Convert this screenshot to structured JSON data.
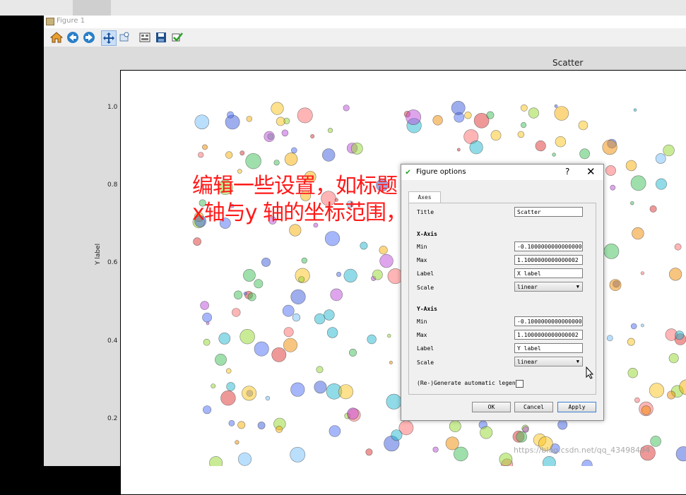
{
  "window": {
    "title": "Figure 1"
  },
  "toolbar": {
    "buttons": [
      "home-icon",
      "back-icon",
      "forward-icon",
      "pan-icon",
      "zoom-icon",
      "subplots-icon",
      "save-icon",
      "figure-options-icon"
    ]
  },
  "plot": {
    "title": "Scatter",
    "ylabel": "Y label",
    "yticks": [
      "1.0",
      "0.8",
      "0.6",
      "0.4",
      "0.2"
    ]
  },
  "annotation": {
    "line1": "编辑一些设置，如标题",
    "line2": "x轴与y 轴的坐标范围，以及x与y标签设置"
  },
  "dialog": {
    "title": "Figure options",
    "help": "?",
    "close": "✕",
    "tab": "Axes",
    "title_label": "Title",
    "title_value": "Scatter",
    "xaxis": {
      "header": "X-Axis",
      "min_label": "Min",
      "min": "-0.10000000000000001",
      "max_label": "Max",
      "max": "1.1000000000000002",
      "label_label": "Label",
      "label": "X label",
      "scale_label": "Scale",
      "scale": "linear"
    },
    "yaxis": {
      "header": "Y-Axis",
      "min_label": "Min",
      "min": "-0.10000000000000001",
      "max_label": "Max",
      "max": "1.1000000000000002",
      "label_label": "Label",
      "label": "Y label",
      "scale_label": "Scale",
      "scale": "linear"
    },
    "legend_label": "(Re-)Generate automatic legend",
    "ok": "OK",
    "cancel": "Cancel",
    "apply": "Apply"
  },
  "watermark": "https://blog.csdn.net/qq_43498494"
}
